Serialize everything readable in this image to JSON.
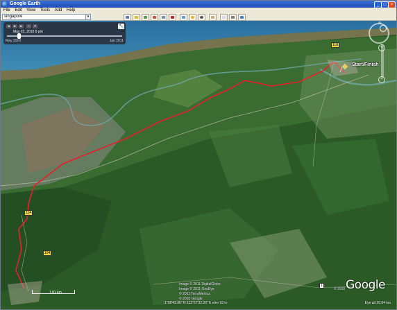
{
  "window": {
    "title": "Google Earth",
    "min": "_",
    "max": "□",
    "close": "×"
  },
  "menu": [
    "File",
    "Edit",
    "View",
    "Tools",
    "Add",
    "Help"
  ],
  "search": {
    "value": "singapore",
    "go": "▾"
  },
  "toolbar": {
    "icons": [
      "hide-sidebar-icon",
      "placemark-icon",
      "polygon-icon",
      "path-icon",
      "image-overlay-icon",
      "record-tour-icon",
      "historical-imagery-icon",
      "sun-icon",
      "planets-icon",
      "ruler-icon",
      "email-icon",
      "print-icon",
      "view-in-maps-icon"
    ]
  },
  "time_slider": {
    "date": "May 22, 2010   5 pm",
    "start": "May 2010",
    "end": "Jan 2011",
    "position": 0.1
  },
  "labels": {
    "start_finish": "Start/Finish",
    "north": "N"
  },
  "roads": {
    "r1": "114",
    "r2": "104",
    "r3": "1",
    "r4": "118"
  },
  "map": {
    "copyright1": "Image © 2011 DigitalGlobe",
    "copyright2": "Image © 2011 GeoEye",
    "copyright3": "© 2011 TerraMetrics",
    "copyright4": "© 2010 Google",
    "copyright_right": "© 2010",
    "scale": "7.81 km",
    "status": "1°58'43.96\" N   113°57'32.26\" E   elev   18 m",
    "eye_alt": "Eye alt   26.64 km",
    "logo": "Google"
  },
  "colors": {
    "track": "#e8202a",
    "pin": "#f3d21a"
  }
}
